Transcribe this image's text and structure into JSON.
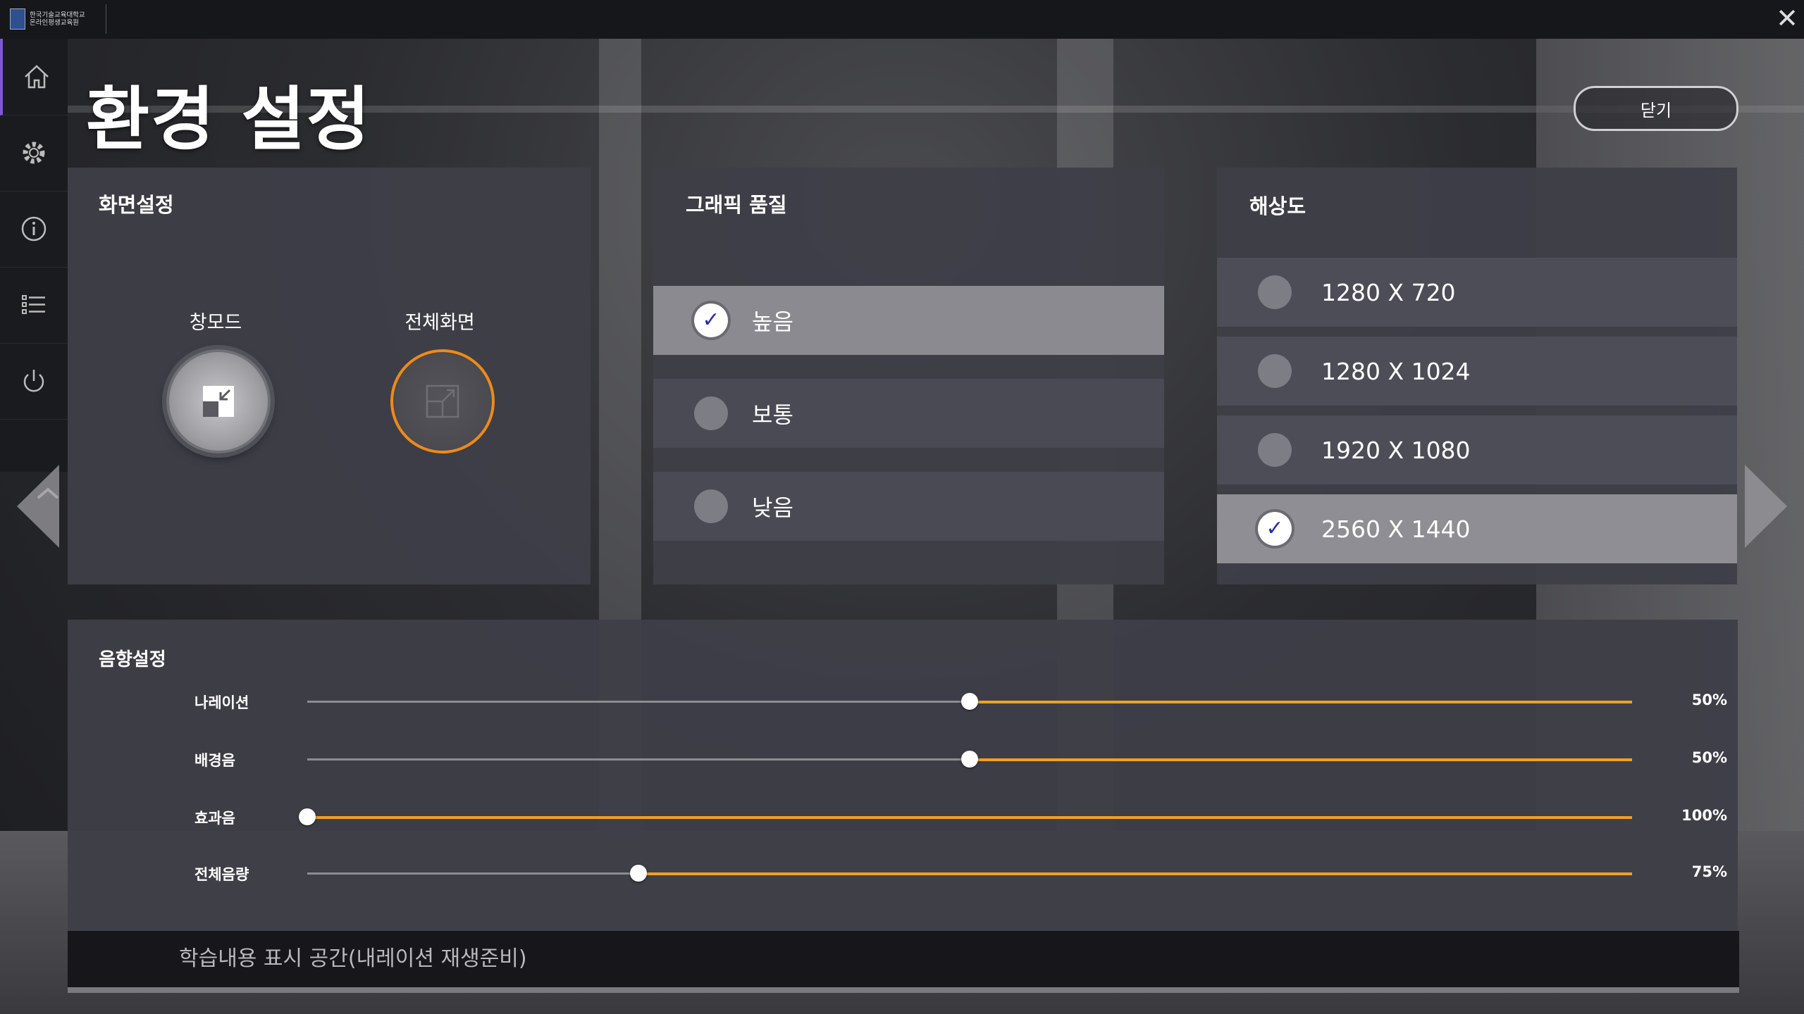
{
  "app": {
    "logo_line1": "한국기술교육대학교",
    "logo_line2": "온라인평생교육원"
  },
  "page": {
    "title": "환경 설정",
    "close_label": "닫기"
  },
  "sidebar": {
    "items": [
      {
        "icon": "home-icon"
      },
      {
        "icon": "gear-icon"
      },
      {
        "icon": "info-icon"
      },
      {
        "icon": "list-icon"
      },
      {
        "icon": "power-icon"
      }
    ]
  },
  "screen_settings": {
    "title": "화면설정",
    "windowed_label": "창모드",
    "fullscreen_label": "전체화면",
    "selected": "전체화면"
  },
  "graphics_quality": {
    "title": "그래픽 품질",
    "options": [
      {
        "label": "높음",
        "selected": true
      },
      {
        "label": "보통",
        "selected": false
      },
      {
        "label": "낮음",
        "selected": false
      }
    ]
  },
  "resolution": {
    "title": "해상도",
    "options": [
      {
        "label": "1280 X 720",
        "selected": false
      },
      {
        "label": "1280 X 1024",
        "selected": false
      },
      {
        "label": "1920 X 1080",
        "selected": false
      },
      {
        "label": "2560 X 1440",
        "selected": true
      }
    ]
  },
  "sound": {
    "title": "음향설정",
    "sliders": [
      {
        "label": "나레이션",
        "value_text": "50%",
        "level": 0.5
      },
      {
        "label": "배경음",
        "value_text": "50%",
        "level": 0.5
      },
      {
        "label": "효과음",
        "value_text": "100%",
        "level": 1.0
      },
      {
        "label": "전체음량",
        "value_text": "75%",
        "level": 0.75
      }
    ]
  },
  "caption": {
    "text": "학습내용 표시 공간(내레이션 재생준비)"
  },
  "colors": {
    "accent": "#f0a021",
    "fullscreen_ring": "#ee8a1a",
    "sidebar_active": "#7d58d6",
    "check": "#2a2ea8"
  }
}
